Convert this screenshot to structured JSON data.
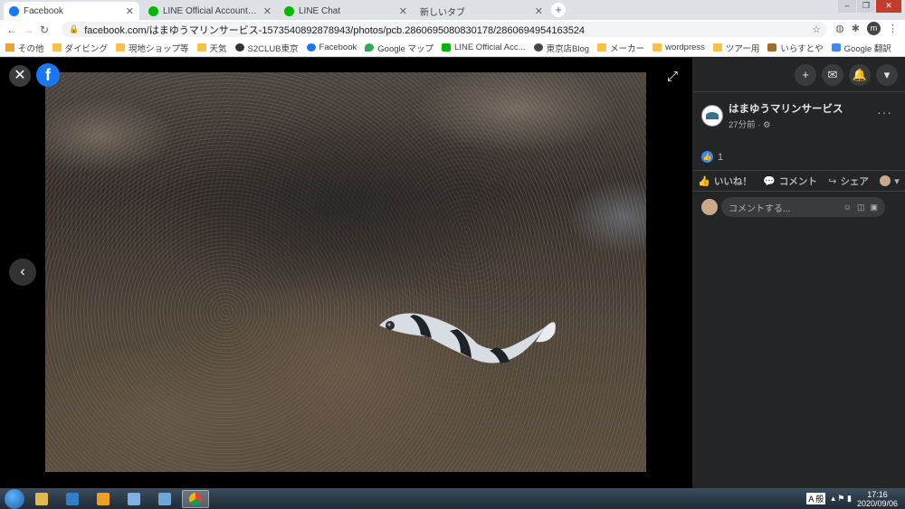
{
  "browser": {
    "tabs": [
      {
        "title": "Facebook",
        "favicon_color": "#1877f2",
        "active": true
      },
      {
        "title": "LINE Official Account Manage",
        "favicon_color": "#00b900",
        "active": false
      },
      {
        "title": "LINE Chat",
        "favicon_color": "#00b900",
        "active": false
      },
      {
        "title": "新しいタブ",
        "favicon_color": "",
        "active": false
      }
    ],
    "new_tab_label": "+",
    "url": "facebook.com/はまゆうマリンサービス-1573540892878943/photos/pcb.2860695080830178/2860694954163524",
    "profile_initial": "m",
    "bookmarks": [
      {
        "label": "その他",
        "icon": "grid-icon"
      },
      {
        "label": "ダイビング",
        "icon": "folder-icon"
      },
      {
        "label": "現地ショップ等",
        "icon": "folder-icon"
      },
      {
        "label": "天気",
        "icon": "folder-icon"
      },
      {
        "label": "S2CLUB東京",
        "icon": "site-icon"
      },
      {
        "label": "Facebook",
        "icon": "facebook-icon"
      },
      {
        "label": "Google マップ",
        "icon": "maps-icon"
      },
      {
        "label": "LINE Official Acc...",
        "icon": "line-icon"
      },
      {
        "label": "東京店Blog",
        "icon": "wordpress-icon"
      },
      {
        "label": "メーカー",
        "icon": "folder-icon"
      },
      {
        "label": "wordpress",
        "icon": "folder-icon"
      },
      {
        "label": "ツアー用",
        "icon": "folder-icon"
      },
      {
        "label": "いらすとや",
        "icon": "site-icon"
      },
      {
        "label": "Google 翻訳",
        "icon": "translate-icon"
      }
    ]
  },
  "viewer": {
    "close_label": "✕",
    "logo_label": "f",
    "prev_label": "‹",
    "fullscreen_label": "⤢"
  },
  "panel": {
    "top_buttons": [
      {
        "name": "create-icon",
        "glyph": "+"
      },
      {
        "name": "messenger-icon",
        "glyph": "✉"
      },
      {
        "name": "notifications-icon",
        "glyph": "🔔"
      },
      {
        "name": "account-menu-icon",
        "glyph": "▾"
      }
    ],
    "author_name": "はまゆうマリンサービス",
    "post_time": "27分前 · ⚙",
    "more_label": "···",
    "like_count": "1",
    "actions": {
      "like": "いいね！",
      "comment": "コメント",
      "share": "シェア"
    },
    "comment_placeholder": "コメントする..."
  },
  "taskbar": {
    "clock_time": "17:16",
    "clock_date": "2020/09/06",
    "ime_label": "A 般"
  }
}
